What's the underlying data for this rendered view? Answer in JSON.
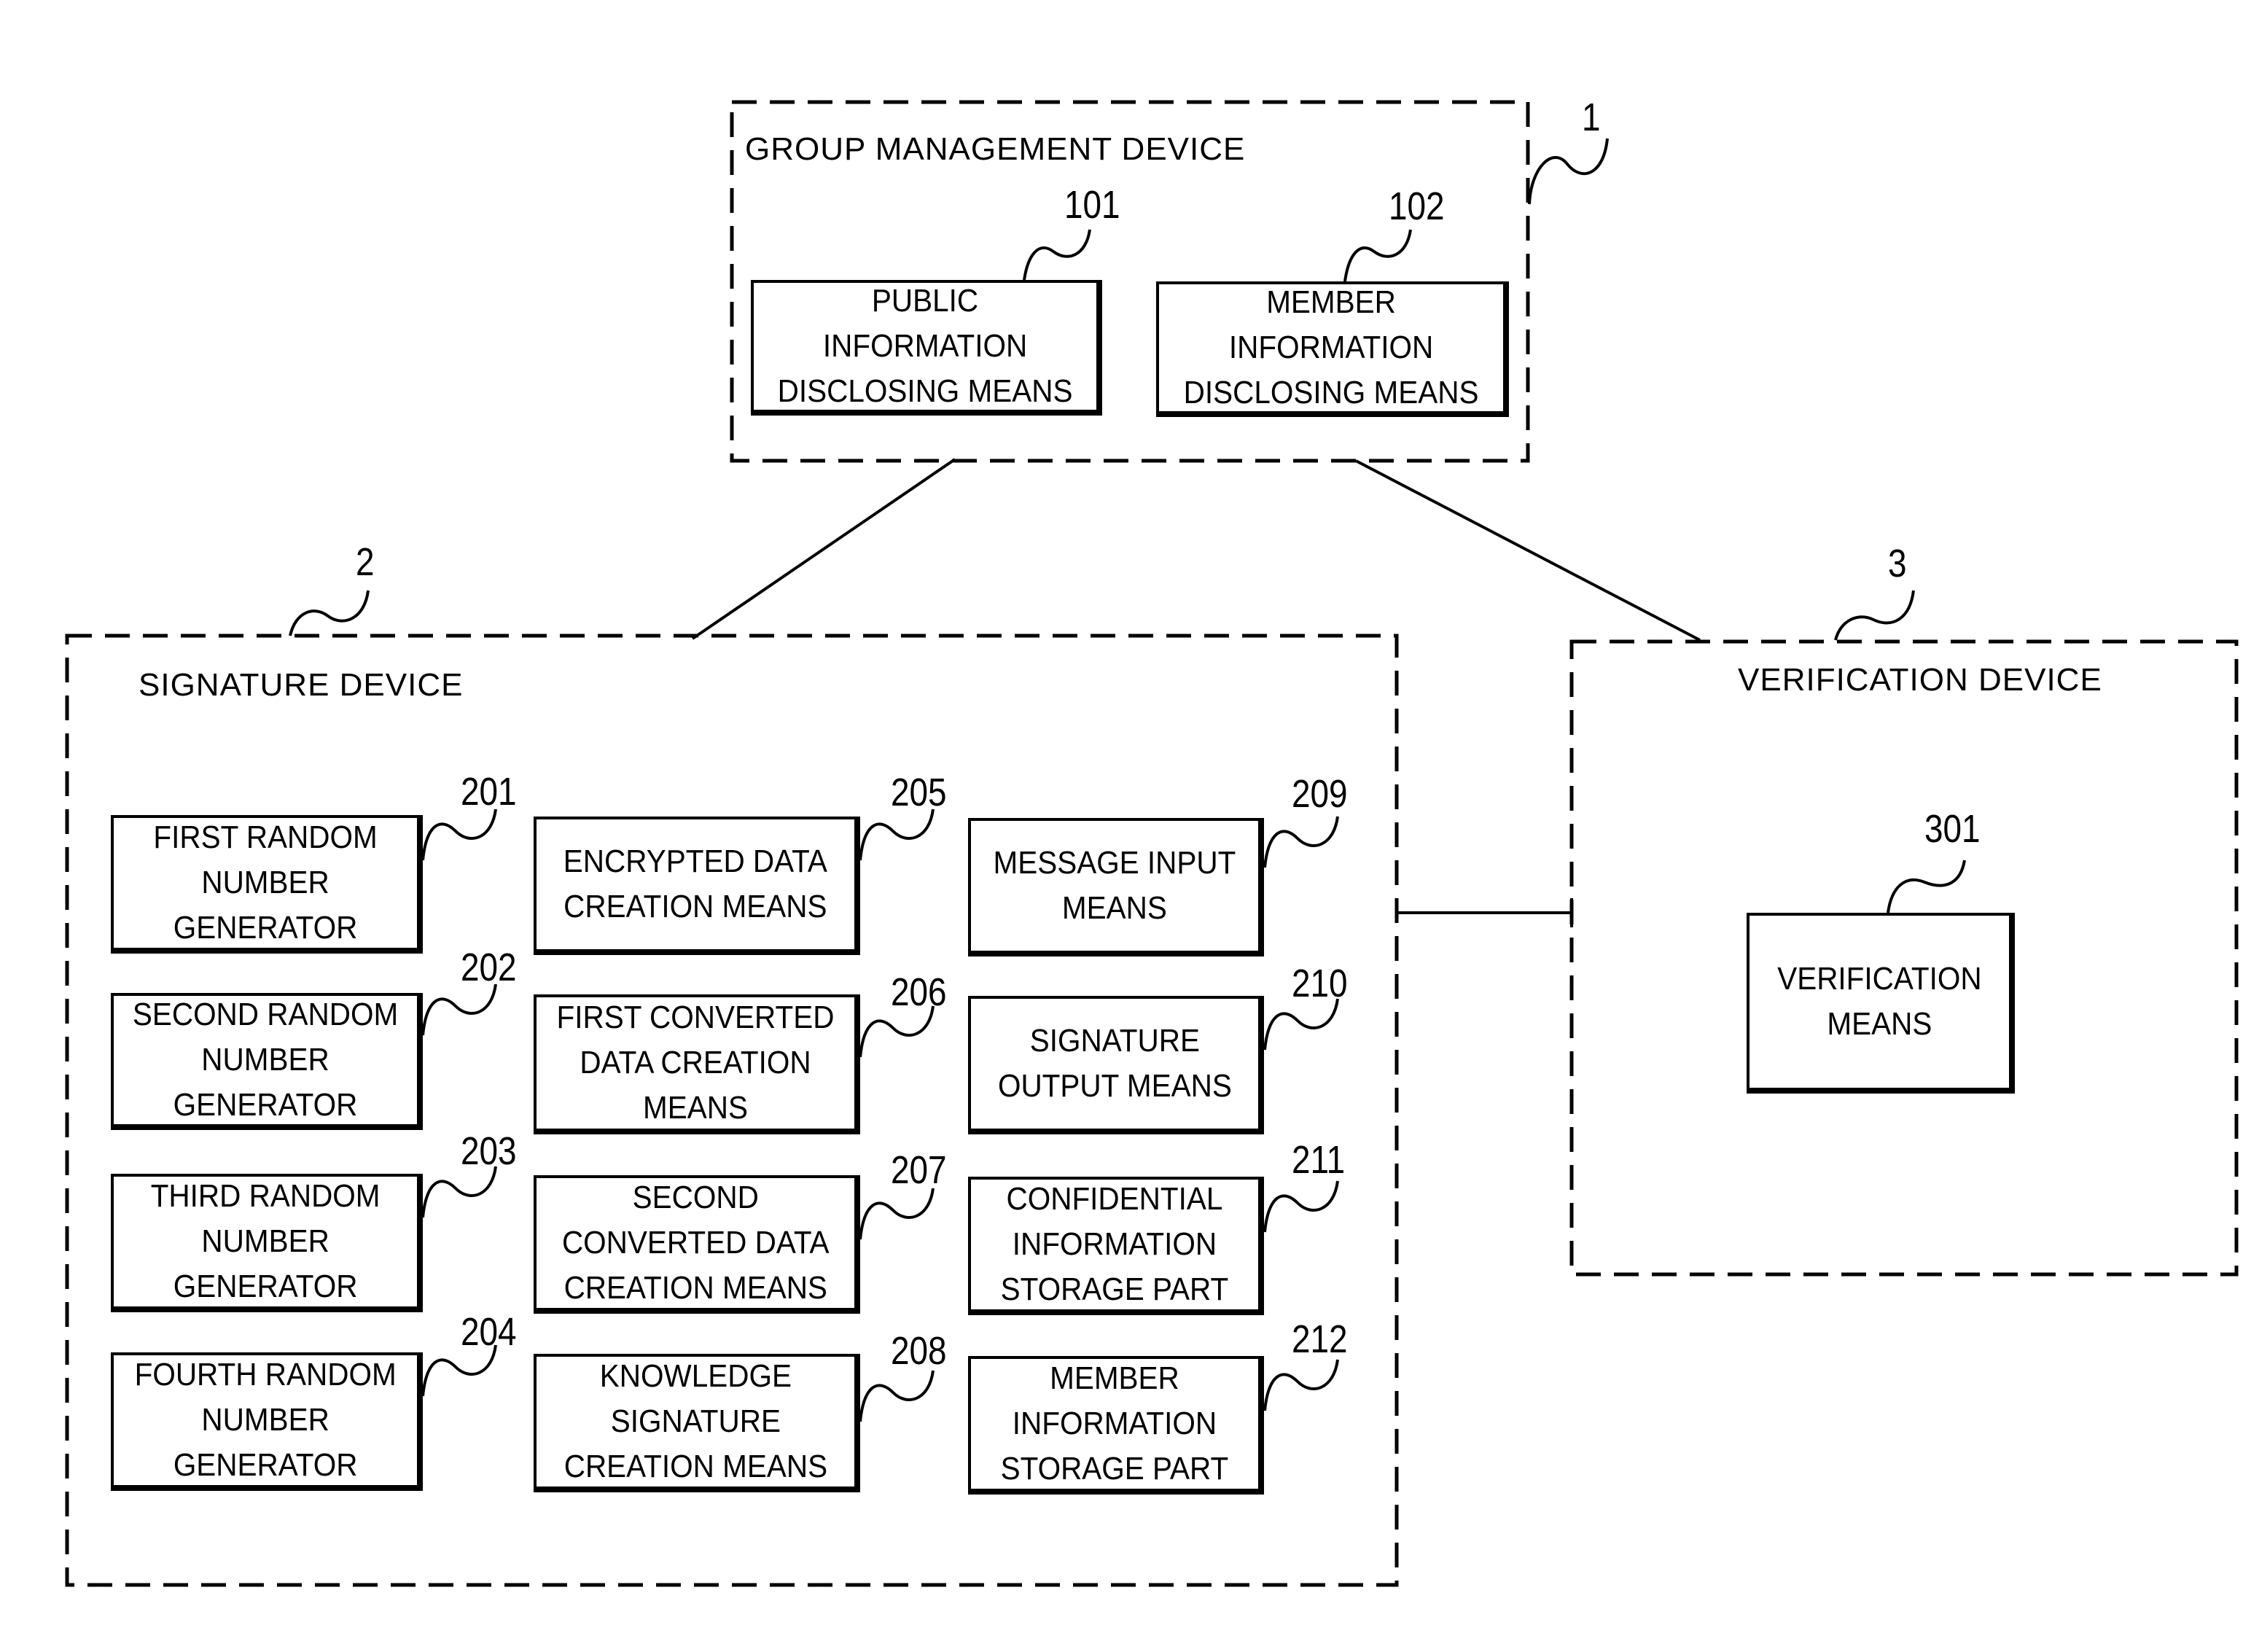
{
  "diagram": {
    "group_management_device": {
      "ref": "1",
      "title": "GROUP MANAGEMENT DEVICE",
      "components": [
        {
          "ref": "101",
          "label": "PUBLIC\nINFORMATION\nDISCLOSING MEANS"
        },
        {
          "ref": "102",
          "label": "MEMBER\nINFORMATION\nDISCLOSING MEANS"
        }
      ]
    },
    "signature_device": {
      "ref": "2",
      "title": "SIGNATURE DEVICE",
      "components": [
        {
          "ref": "201",
          "label": "FIRST RANDOM\nNUMBER\nGENERATOR"
        },
        {
          "ref": "202",
          "label": "SECOND RANDOM\nNUMBER\nGENERATOR"
        },
        {
          "ref": "203",
          "label": "THIRD RANDOM\nNUMBER\nGENERATOR"
        },
        {
          "ref": "204",
          "label": "FOURTH RANDOM\nNUMBER\nGENERATOR"
        },
        {
          "ref": "205",
          "label": "ENCRYPTED DATA\nCREATION MEANS"
        },
        {
          "ref": "206",
          "label": "FIRST CONVERTED\nDATA CREATION\nMEANS"
        },
        {
          "ref": "207",
          "label": "SECOND\nCONVERTED DATA\nCREATION MEANS"
        },
        {
          "ref": "208",
          "label": "KNOWLEDGE\nSIGNATURE\nCREATION MEANS"
        },
        {
          "ref": "209",
          "label": "MESSAGE INPUT\nMEANS"
        },
        {
          "ref": "210",
          "label": "SIGNATURE\nOUTPUT MEANS"
        },
        {
          "ref": "211",
          "label": "CONFIDENTIAL\nINFORMATION\nSTORAGE PART"
        },
        {
          "ref": "212",
          "label": "MEMBER\nINFORMATION\nSTORAGE PART"
        }
      ]
    },
    "verification_device": {
      "ref": "3",
      "title": "VERIFICATION DEVICE",
      "components": [
        {
          "ref": "301",
          "label": "VERIFICATION\nMEANS"
        }
      ]
    }
  }
}
